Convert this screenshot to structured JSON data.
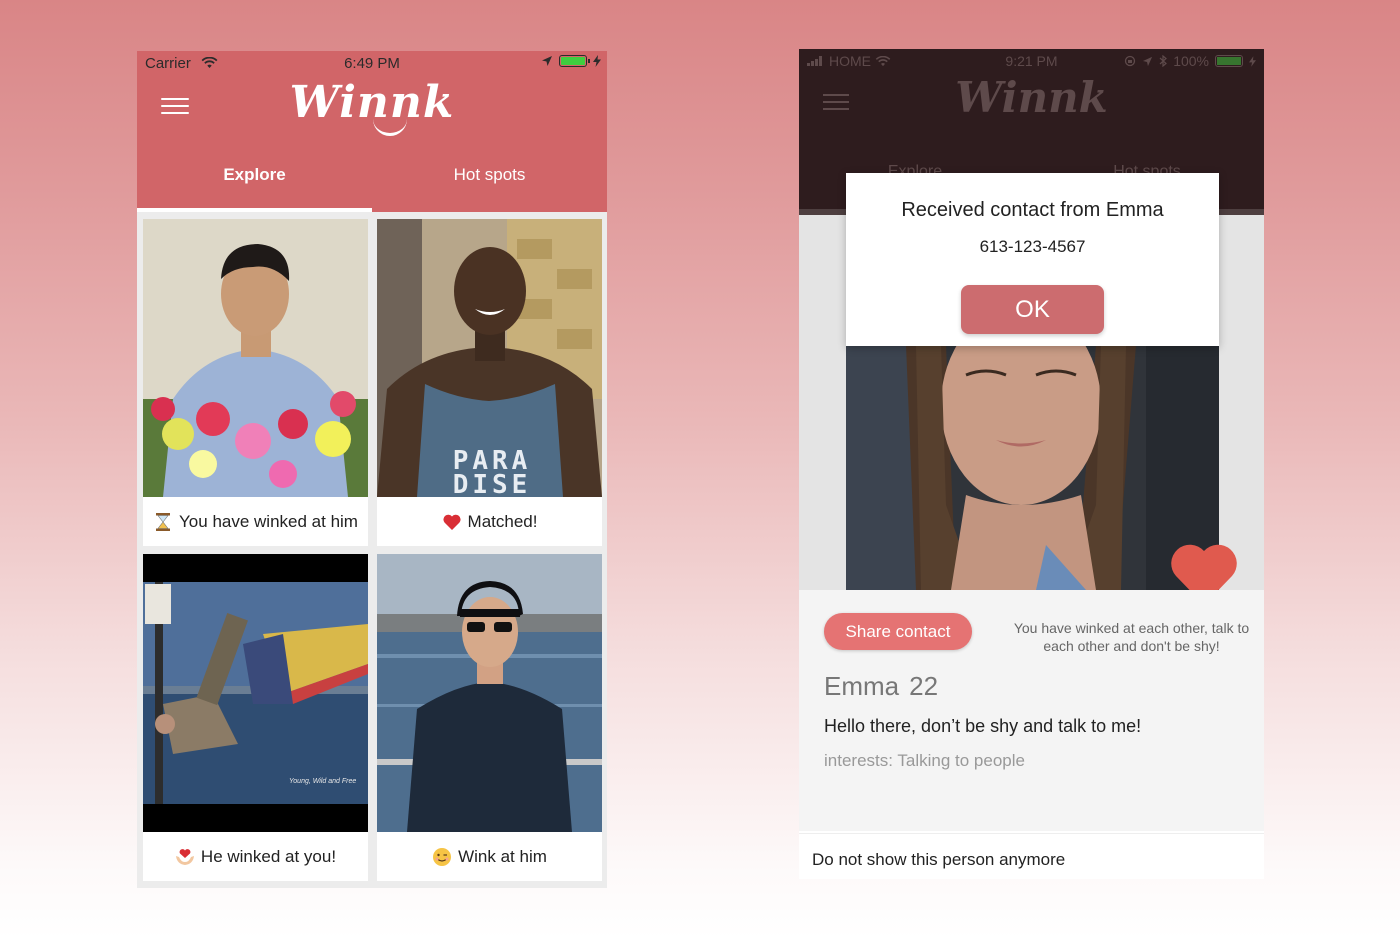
{
  "left_phone": {
    "status": {
      "carrier": "Carrier",
      "time": "6:49 PM"
    },
    "logo": "Winnk",
    "tabs": [
      {
        "label": "Explore",
        "active": true
      },
      {
        "label": "Hot spots",
        "active": false
      }
    ],
    "cards": [
      {
        "label": "You have winked at him",
        "icon": "hourglass-icon"
      },
      {
        "label": "Matched!",
        "icon": "heart-icon"
      },
      {
        "label": "He winked at you!",
        "icon": "heart-hands-icon"
      },
      {
        "label": "Wink at him",
        "icon": "wink-face-icon"
      }
    ],
    "photo_caption": "Young, Wild and Free",
    "shirt_text": "PARA DISE"
  },
  "right_phone": {
    "status": {
      "carrier": "HOME",
      "time": "9:21 PM",
      "battery": "100%"
    },
    "logo": "Winnk",
    "tabs": [
      {
        "label": "Explore"
      },
      {
        "label": "Hot spots"
      }
    ],
    "dialog": {
      "title": "Received contact from Emma",
      "phone": "613-123-4567",
      "ok_label": "OK"
    },
    "profile": {
      "share_label": "Share contact",
      "wink_message": "You have winked at each other, talk to each other and don't be shy!",
      "name": "Emma",
      "age": "22",
      "bio": "Hello there, don’t be shy and talk to me!",
      "interests": "interests: Talking to people"
    },
    "footer": "Do not show this person anymore"
  },
  "colors": {
    "brand": "#d16568",
    "button": "#e57373",
    "ok_button": "#cc6c6f",
    "heart": "#e05a4e"
  }
}
